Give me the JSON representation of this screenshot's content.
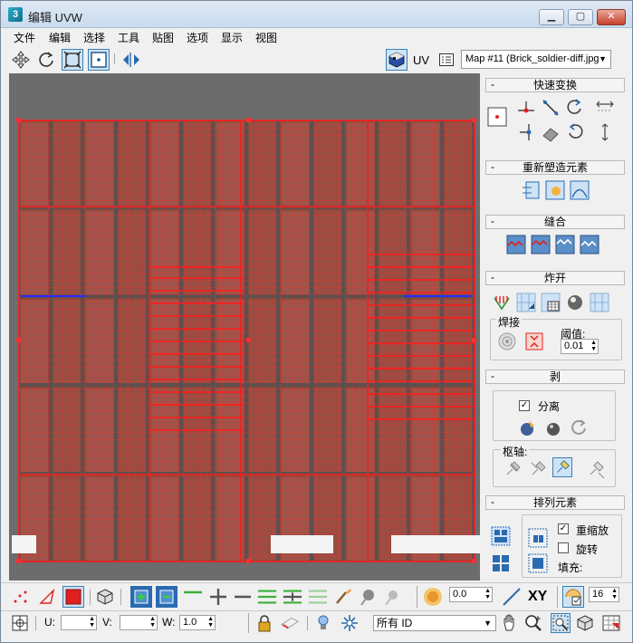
{
  "window": {
    "title": "编辑 UVW",
    "app_icon": "3ds-max-icon",
    "buttons": [
      "minimize",
      "maximize",
      "close"
    ]
  },
  "menubar": {
    "items": [
      "文件",
      "编辑",
      "选择",
      "工具",
      "贴图",
      "选项",
      "显示",
      "视图"
    ]
  },
  "toolbar": {
    "uv_label": "UV",
    "map_select": "Map #11 (Brick_soldier-diff.jpg"
  },
  "panel": {
    "quick_transform": "快速变换",
    "reshape": "重新塑造元素",
    "stitch": "缝合",
    "explode": "炸开",
    "weld": "焊接",
    "threshold_label": "阈值:",
    "threshold_value": "0.01",
    "peel": "剥",
    "detach_label": "分离",
    "detach_checked": true,
    "pivot_label": "枢轴:",
    "arrange": "排列元素",
    "rescale_label": "重缩放",
    "rescale_checked": true,
    "rotate_label": "旋转",
    "rotate_checked": false,
    "padding_label": "填充:"
  },
  "bottom1": {
    "spin_value": "0.0",
    "xy_label": "XY",
    "grid_value": "16"
  },
  "bottom2": {
    "u_label": "U:",
    "u_value": "",
    "v_label": "V:",
    "v_value": "",
    "w_label": "W:",
    "w_value": "1.0",
    "id_select": "所有 ID"
  },
  "colors": {
    "accent": "#3c7fb1",
    "uv_grid": "#e00000",
    "viewport_bg": "#6c6c6c"
  }
}
